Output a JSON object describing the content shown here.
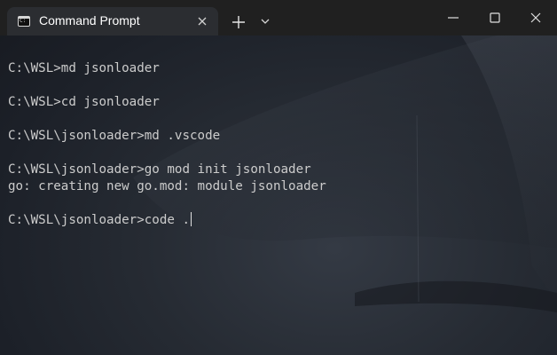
{
  "window": {
    "tab_title": "Command Prompt",
    "tab_icon": "command-prompt-icon",
    "close_tab_icon": "close-icon",
    "new_tab_icon": "plus-icon",
    "dropdown_icon": "chevron-down-icon",
    "minimize_icon": "minimize-icon",
    "maximize_icon": "maximize-icon",
    "close_window_icon": "close-icon"
  },
  "terminal": {
    "lines": [
      "",
      "C:\\WSL>md jsonloader",
      "",
      "C:\\WSL>cd jsonloader",
      "",
      "C:\\WSL\\jsonloader>md .vscode",
      "",
      "C:\\WSL\\jsonloader>go mod init jsonloader",
      "go: creating new go.mod: module jsonloader",
      "",
      "C:\\WSL\\jsonloader>code ."
    ]
  },
  "colors": {
    "titlebar": "#202020",
    "tab": "#2b2d31",
    "text": "#cccccc"
  }
}
